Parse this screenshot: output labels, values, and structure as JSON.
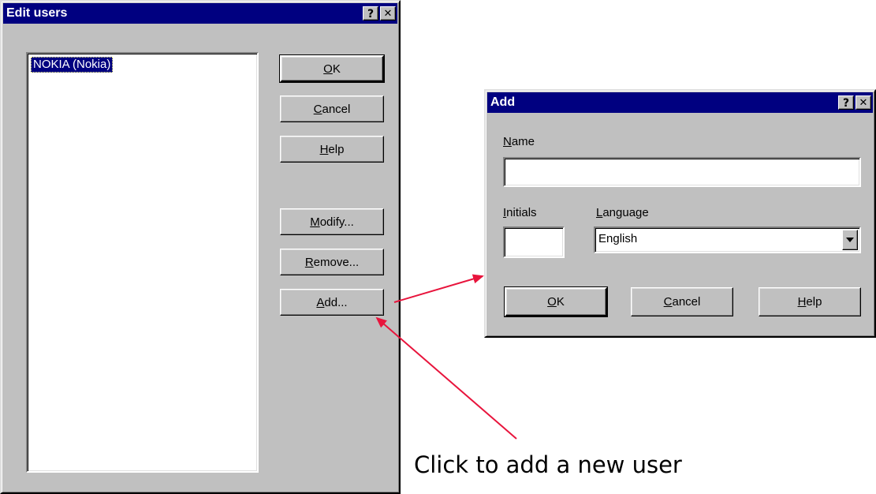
{
  "edit_users": {
    "title": "Edit users",
    "help_glyph": "?",
    "close_glyph": "✕",
    "users": [
      "NOKIA (Nokia)"
    ],
    "buttons": {
      "ok": {
        "first": "O",
        "rest": "K"
      },
      "cancel": {
        "first": "C",
        "rest": "ancel"
      },
      "help": {
        "first": "H",
        "rest": "elp"
      },
      "modify": {
        "first": "M",
        "rest": "odify..."
      },
      "remove": {
        "first": "R",
        "rest": "emove..."
      },
      "add": {
        "first": "A",
        "rest": "dd..."
      }
    }
  },
  "add_dialog": {
    "title": "Add",
    "help_glyph": "?",
    "close_glyph": "✕",
    "name_label": {
      "first": "N",
      "rest": "ame"
    },
    "name_value": "",
    "initials_label": {
      "first": "I",
      "rest": "nitials"
    },
    "initials_value": "",
    "language_label": {
      "first": "L",
      "rest": "anguage"
    },
    "language_value": "English",
    "buttons": {
      "ok": {
        "first": "O",
        "rest": "K"
      },
      "cancel": {
        "first": "C",
        "rest": "ancel"
      },
      "help": {
        "first": "H",
        "rest": "elp"
      }
    }
  },
  "annotation": {
    "callout_text": "Click to add a new user",
    "arrow_color": "#e8143c"
  },
  "icons": {
    "dropdown": "chevron-down-icon"
  }
}
